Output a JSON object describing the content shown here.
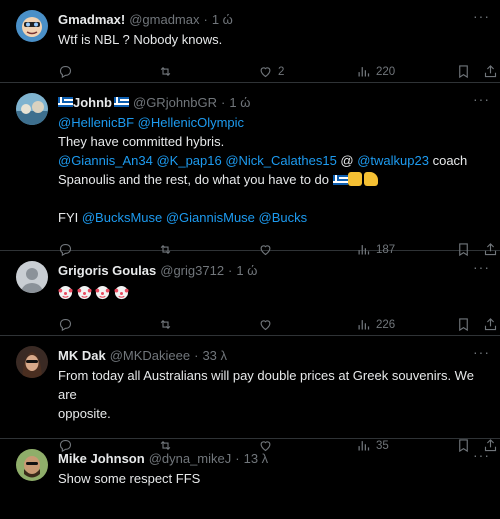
{
  "tweets": [
    {
      "name": "Gmadmax!",
      "handle": "@gmadmax",
      "time": "1 ώ",
      "text_lines": [
        "Wtf is NBL ? Nobody knows."
      ],
      "likes": "2",
      "views": "220",
      "avatar_color": "#4a90c8"
    },
    {
      "name": "Johnb",
      "handle": "@GRjohnbGR",
      "time": "1 ώ",
      "mentions1": "@HellenicBF @HellenicOlympic",
      "line2": "They have committed hybris.",
      "mentions3": "@Giannis_An34 @K_pap16 @Nick_Calathes15",
      "line3_mid": " @ ",
      "mention3b": "@twalkup23",
      "line3_end": " coach",
      "line4": "Spanoulis and the rest, do what you have to do",
      "fyi_label": "FYI ",
      "fyi_mentions": "@BucksMuse @GiannisMuse @Bucks",
      "likes": "",
      "views": "187",
      "avatar_color": "#5b8fa8"
    },
    {
      "name": "Grigoris Goulas",
      "handle": "@grig3712",
      "time": "1 ώ",
      "views": "226",
      "avatar_color": "#b9bec4"
    },
    {
      "name": "MK Dak",
      "handle": "@MKDakieee",
      "time": "33 λ",
      "text_lines": [
        "From today all Australians will pay double prices at Greek souvenirs. We are",
        "opposite."
      ],
      "views": "35",
      "avatar_color": "#6b4a3a"
    },
    {
      "name": "Mike Johnson",
      "handle": "@dyna_mikeJ",
      "time": "13 λ",
      "text_lines": [
        "Show some respect FFS"
      ],
      "avatar_color": "#7a6a50"
    }
  ],
  "icons": {
    "reply": "reply-icon",
    "retweet": "retweet-icon",
    "like": "like-icon",
    "views": "views-icon",
    "bookmark": "bookmark-icon",
    "share": "share-icon",
    "more": "more-icon"
  },
  "colors": {
    "link": "#1d9bf0",
    "muted": "#71767b",
    "text": "#e7e9ea",
    "divider": "#2f3336"
  }
}
